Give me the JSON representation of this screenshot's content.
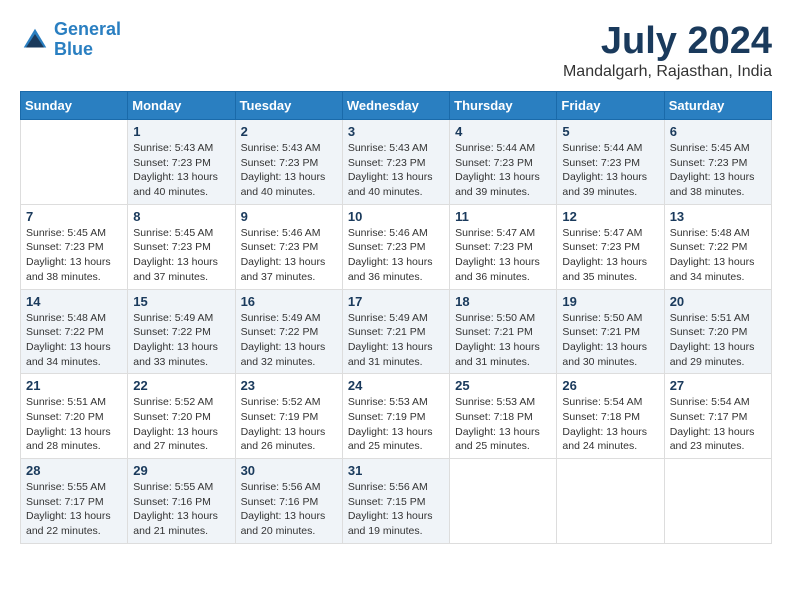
{
  "logo": {
    "line1": "General",
    "line2": "Blue"
  },
  "title": "July 2024",
  "subtitle": "Mandalgarh, Rajasthan, India",
  "weekdays": [
    "Sunday",
    "Monday",
    "Tuesday",
    "Wednesday",
    "Thursday",
    "Friday",
    "Saturday"
  ],
  "weeks": [
    [
      {
        "day": "",
        "info": ""
      },
      {
        "day": "1",
        "info": "Sunrise: 5:43 AM\nSunset: 7:23 PM\nDaylight: 13 hours\nand 40 minutes."
      },
      {
        "day": "2",
        "info": "Sunrise: 5:43 AM\nSunset: 7:23 PM\nDaylight: 13 hours\nand 40 minutes."
      },
      {
        "day": "3",
        "info": "Sunrise: 5:43 AM\nSunset: 7:23 PM\nDaylight: 13 hours\nand 40 minutes."
      },
      {
        "day": "4",
        "info": "Sunrise: 5:44 AM\nSunset: 7:23 PM\nDaylight: 13 hours\nand 39 minutes."
      },
      {
        "day": "5",
        "info": "Sunrise: 5:44 AM\nSunset: 7:23 PM\nDaylight: 13 hours\nand 39 minutes."
      },
      {
        "day": "6",
        "info": "Sunrise: 5:45 AM\nSunset: 7:23 PM\nDaylight: 13 hours\nand 38 minutes."
      }
    ],
    [
      {
        "day": "7",
        "info": "Sunrise: 5:45 AM\nSunset: 7:23 PM\nDaylight: 13 hours\nand 38 minutes."
      },
      {
        "day": "8",
        "info": "Sunrise: 5:45 AM\nSunset: 7:23 PM\nDaylight: 13 hours\nand 37 minutes."
      },
      {
        "day": "9",
        "info": "Sunrise: 5:46 AM\nSunset: 7:23 PM\nDaylight: 13 hours\nand 37 minutes."
      },
      {
        "day": "10",
        "info": "Sunrise: 5:46 AM\nSunset: 7:23 PM\nDaylight: 13 hours\nand 36 minutes."
      },
      {
        "day": "11",
        "info": "Sunrise: 5:47 AM\nSunset: 7:23 PM\nDaylight: 13 hours\nand 36 minutes."
      },
      {
        "day": "12",
        "info": "Sunrise: 5:47 AM\nSunset: 7:23 PM\nDaylight: 13 hours\nand 35 minutes."
      },
      {
        "day": "13",
        "info": "Sunrise: 5:48 AM\nSunset: 7:22 PM\nDaylight: 13 hours\nand 34 minutes."
      }
    ],
    [
      {
        "day": "14",
        "info": "Sunrise: 5:48 AM\nSunset: 7:22 PM\nDaylight: 13 hours\nand 34 minutes."
      },
      {
        "day": "15",
        "info": "Sunrise: 5:49 AM\nSunset: 7:22 PM\nDaylight: 13 hours\nand 33 minutes."
      },
      {
        "day": "16",
        "info": "Sunrise: 5:49 AM\nSunset: 7:22 PM\nDaylight: 13 hours\nand 32 minutes."
      },
      {
        "day": "17",
        "info": "Sunrise: 5:49 AM\nSunset: 7:21 PM\nDaylight: 13 hours\nand 31 minutes."
      },
      {
        "day": "18",
        "info": "Sunrise: 5:50 AM\nSunset: 7:21 PM\nDaylight: 13 hours\nand 31 minutes."
      },
      {
        "day": "19",
        "info": "Sunrise: 5:50 AM\nSunset: 7:21 PM\nDaylight: 13 hours\nand 30 minutes."
      },
      {
        "day": "20",
        "info": "Sunrise: 5:51 AM\nSunset: 7:20 PM\nDaylight: 13 hours\nand 29 minutes."
      }
    ],
    [
      {
        "day": "21",
        "info": "Sunrise: 5:51 AM\nSunset: 7:20 PM\nDaylight: 13 hours\nand 28 minutes."
      },
      {
        "day": "22",
        "info": "Sunrise: 5:52 AM\nSunset: 7:20 PM\nDaylight: 13 hours\nand 27 minutes."
      },
      {
        "day": "23",
        "info": "Sunrise: 5:52 AM\nSunset: 7:19 PM\nDaylight: 13 hours\nand 26 minutes."
      },
      {
        "day": "24",
        "info": "Sunrise: 5:53 AM\nSunset: 7:19 PM\nDaylight: 13 hours\nand 25 minutes."
      },
      {
        "day": "25",
        "info": "Sunrise: 5:53 AM\nSunset: 7:18 PM\nDaylight: 13 hours\nand 25 minutes."
      },
      {
        "day": "26",
        "info": "Sunrise: 5:54 AM\nSunset: 7:18 PM\nDaylight: 13 hours\nand 24 minutes."
      },
      {
        "day": "27",
        "info": "Sunrise: 5:54 AM\nSunset: 7:17 PM\nDaylight: 13 hours\nand 23 minutes."
      }
    ],
    [
      {
        "day": "28",
        "info": "Sunrise: 5:55 AM\nSunset: 7:17 PM\nDaylight: 13 hours\nand 22 minutes."
      },
      {
        "day": "29",
        "info": "Sunrise: 5:55 AM\nSunset: 7:16 PM\nDaylight: 13 hours\nand 21 minutes."
      },
      {
        "day": "30",
        "info": "Sunrise: 5:56 AM\nSunset: 7:16 PM\nDaylight: 13 hours\nand 20 minutes."
      },
      {
        "day": "31",
        "info": "Sunrise: 5:56 AM\nSunset: 7:15 PM\nDaylight: 13 hours\nand 19 minutes."
      },
      {
        "day": "",
        "info": ""
      },
      {
        "day": "",
        "info": ""
      },
      {
        "day": "",
        "info": ""
      }
    ]
  ]
}
